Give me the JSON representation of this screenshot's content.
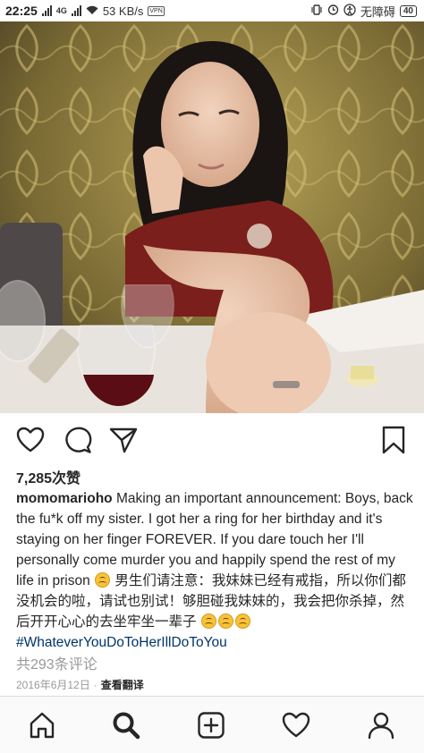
{
  "status_bar": {
    "time": "22:25",
    "network_type": "4G",
    "speed": "53 KB/s",
    "vpn": "VPN",
    "accessibility": "无障碍",
    "battery": "40"
  },
  "post": {
    "image_icon": "photo-of-woman-showing-ring",
    "likes": "7,285次赞",
    "caption": {
      "username": "momomarioho",
      "text_part1": " Making an important announcement: Boys, back the fu*k off my sister. I got her a ring for her birthday and it's staying on her finger FOREVER. If you dare touch her I'll personally come murder you and happily spend the rest of my life in prison ",
      "text_part2": " 男生们请注意：我妹妹已经有戒指，所以你们都没机会的啦，请试也别试！够胆碰我妹妹的，我会把你杀掉，然后开开心心的去坐牢坐一辈子 ",
      "hashtag": "#WhateverYouDoToHerIllDoToYou"
    },
    "comments": "共293条评论",
    "date": "2016年6月12日",
    "separator": "·",
    "translate": "查看翻译"
  },
  "actions": {
    "like_icon": "heart-icon",
    "comment_icon": "comment-icon",
    "share_icon": "send-icon",
    "save_icon": "bookmark-icon"
  },
  "bottom_nav": {
    "items": [
      "home-icon",
      "search-icon",
      "add-post-icon",
      "activity-heart-icon",
      "profile-icon"
    ]
  }
}
